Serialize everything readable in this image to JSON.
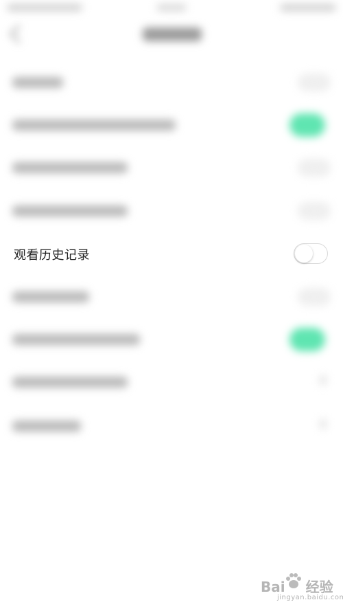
{
  "settings": {
    "rows": [
      {
        "label": "观看历史记录",
        "toggle": "off"
      }
    ]
  },
  "watermark": {
    "brand": "Bai",
    "brand_suffix": "经验",
    "site": "jingyan.baidu.com"
  },
  "colors": {
    "toggle_on": "#5fe5b1",
    "text_primary": "#222222",
    "toggle_off_border": "#d9d9d9"
  }
}
